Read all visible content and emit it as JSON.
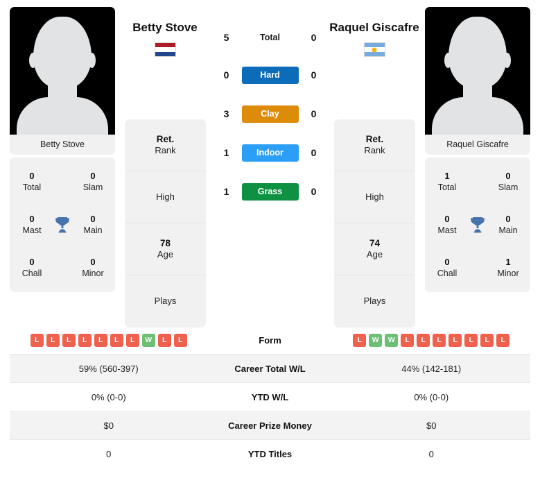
{
  "players": {
    "left": {
      "name": "Betty Stove",
      "photo_caption": "Betty Stove",
      "country": "Netherlands",
      "flag": "nl-flag-icon",
      "achievements": [
        {
          "value": "0",
          "label": "Total"
        },
        {
          "value": "0",
          "label": "Slam"
        },
        {
          "value": "0",
          "label": "Mast"
        },
        {
          "value": "0",
          "label": "Main"
        },
        {
          "value": "0",
          "label": "Chall"
        },
        {
          "value": "0",
          "label": "Minor"
        }
      ],
      "info": {
        "rank_value": "Ret.",
        "rank_label": "Rank",
        "high_value": "",
        "high_label": "High",
        "age_value": "78",
        "age_label": "Age",
        "plays_value": "",
        "plays_label": "Plays"
      },
      "surfaces": {
        "total": "5",
        "hard": "0",
        "clay": "3",
        "indoor": "1",
        "grass": "1"
      },
      "form": [
        "L",
        "L",
        "L",
        "L",
        "L",
        "L",
        "L",
        "W",
        "L",
        "L"
      ],
      "career_total_wl": "59% (560-397)",
      "ytd_wl": "0% (0-0)",
      "career_prize_money": "$0",
      "ytd_titles": "0"
    },
    "right": {
      "name": "Raquel Giscafre",
      "photo_caption": "Raquel Giscafre",
      "country": "Argentina",
      "flag": "ar-flag-icon",
      "achievements": [
        {
          "value": "1",
          "label": "Total"
        },
        {
          "value": "0",
          "label": "Slam"
        },
        {
          "value": "0",
          "label": "Mast"
        },
        {
          "value": "0",
          "label": "Main"
        },
        {
          "value": "0",
          "label": "Chall"
        },
        {
          "value": "1",
          "label": "Minor"
        }
      ],
      "info": {
        "rank_value": "Ret.",
        "rank_label": "Rank",
        "high_value": "",
        "high_label": "High",
        "age_value": "74",
        "age_label": "Age",
        "plays_value": "",
        "plays_label": "Plays"
      },
      "surfaces": {
        "total": "0",
        "hard": "0",
        "clay": "0",
        "indoor": "0",
        "grass": "0"
      },
      "form": [
        "L",
        "W",
        "W",
        "L",
        "L",
        "L",
        "L",
        "L",
        "L",
        "L"
      ],
      "career_total_wl": "44% (142-181)",
      "ytd_wl": "0% (0-0)",
      "career_prize_money": "$0",
      "ytd_titles": "0"
    }
  },
  "surface_labels": {
    "total": "Total",
    "hard": "Hard",
    "clay": "Clay",
    "indoor": "Indoor",
    "grass": "Grass"
  },
  "stat_labels": {
    "form": "Form",
    "career_total_wl": "Career Total W/L",
    "ytd_wl": "YTD W/L",
    "career_prize_money": "Career Prize Money",
    "ytd_titles": "YTD Titles"
  },
  "colors": {
    "hard": "#0c6cba",
    "clay": "#dd8c0a",
    "indoor": "#2b9ef5",
    "grass": "#0e9143",
    "win": "#6cbf73",
    "loss": "#f0604d",
    "trophy": "#4674ab",
    "card_bg": "#f1f1f1",
    "row_alt": "#f3f3f3"
  },
  "icons": {
    "trophy": "trophy-icon",
    "avatar": "avatar-placeholder-icon"
  }
}
